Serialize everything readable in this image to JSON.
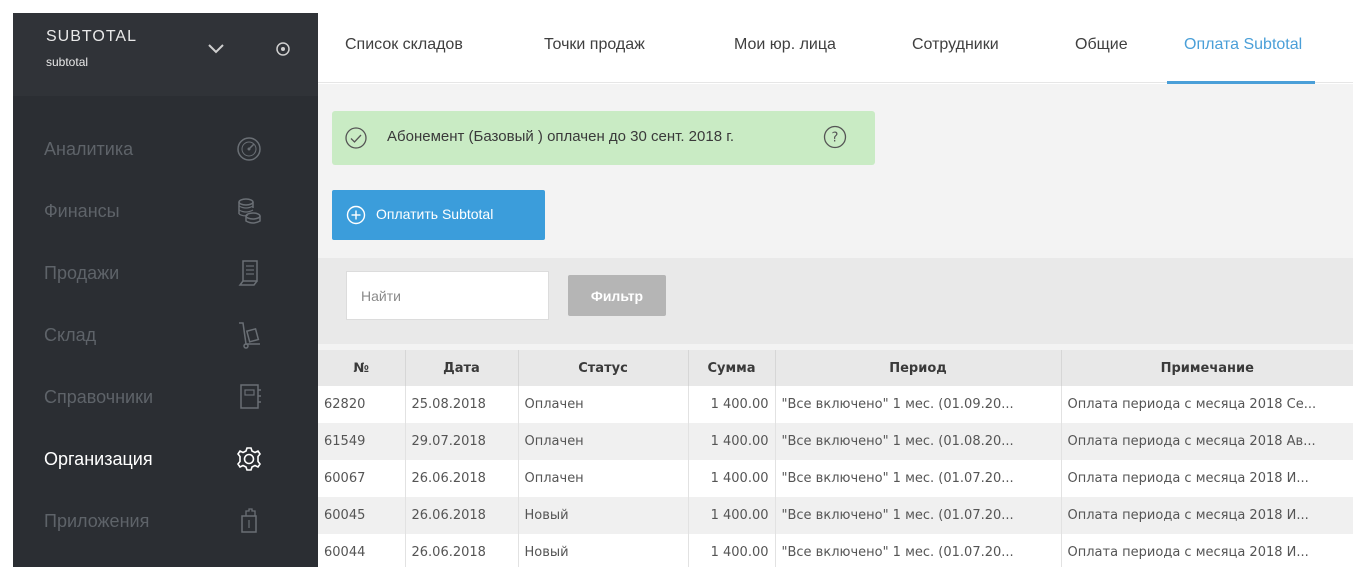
{
  "sidebar": {
    "brand_title": "SUBTOTAL",
    "brand_sub": "subtotal",
    "items": [
      {
        "label": "Аналитика",
        "icon": "speedometer-icon",
        "active": false
      },
      {
        "label": "Финансы",
        "icon": "coins-icon",
        "active": false
      },
      {
        "label": "Продажи",
        "icon": "receipt-icon",
        "active": false
      },
      {
        "label": "Склад",
        "icon": "dolly-icon",
        "active": false
      },
      {
        "label": "Справочники",
        "icon": "book-icon",
        "active": false
      },
      {
        "label": "Организация",
        "icon": "gear-icon",
        "active": true
      },
      {
        "label": "Приложения",
        "icon": "puzzle-icon",
        "active": false
      }
    ]
  },
  "tabs": [
    {
      "label": "Список складов"
    },
    {
      "label": "Точки продаж"
    },
    {
      "label": "Мои юр. лица"
    },
    {
      "label": "Сотрудники"
    },
    {
      "label": "Общие"
    },
    {
      "label": "Оплата Subtotal"
    }
  ],
  "active_tab": "Оплата Subtotal",
  "notice": {
    "text": "Абонемент (Базовый ) оплачен до 30 сент. 2018 г."
  },
  "pay_button": {
    "label": "Оплатить Subtotal"
  },
  "search": {
    "placeholder": "Найти"
  },
  "filter_button": {
    "label": "Фильтр"
  },
  "table": {
    "columns": [
      "№",
      "Дата",
      "Статус",
      "Сумма",
      "Период",
      "Примечание"
    ],
    "rows": [
      [
        "62820",
        "25.08.2018",
        "Оплачен",
        "1 400.00",
        "\"Все включено\" 1 мес. (01.09.20...",
        "Оплата периода с месяца 2018 Се..."
      ],
      [
        "61549",
        "29.07.2018",
        "Оплачен",
        "1 400.00",
        "\"Все включено\" 1 мес. (01.08.20...",
        "Оплата периода с месяца 2018 Ав..."
      ],
      [
        "60067",
        "26.06.2018",
        "Оплачен",
        "1 400.00",
        "\"Все включено\" 1 мес. (01.07.20...",
        "Оплата периода с месяца 2018 И..."
      ],
      [
        "60045",
        "26.06.2018",
        "Новый",
        "1 400.00",
        "\"Все включено\" 1 мес. (01.07.20...",
        "Оплата периода с месяца 2018 И..."
      ],
      [
        "60044",
        "26.06.2018",
        "Новый",
        "1 400.00",
        "\"Все включено\" 1 мес. (01.07.20...",
        "Оплата периода с месяца 2018 И..."
      ]
    ]
  },
  "colors": {
    "sidebar_bg": "#2b2e33",
    "accent": "#4a9fd8",
    "notice_bg": "#c9ebc4",
    "button_blue": "#3b9ddb",
    "filter_gray": "#b5b5b5"
  }
}
